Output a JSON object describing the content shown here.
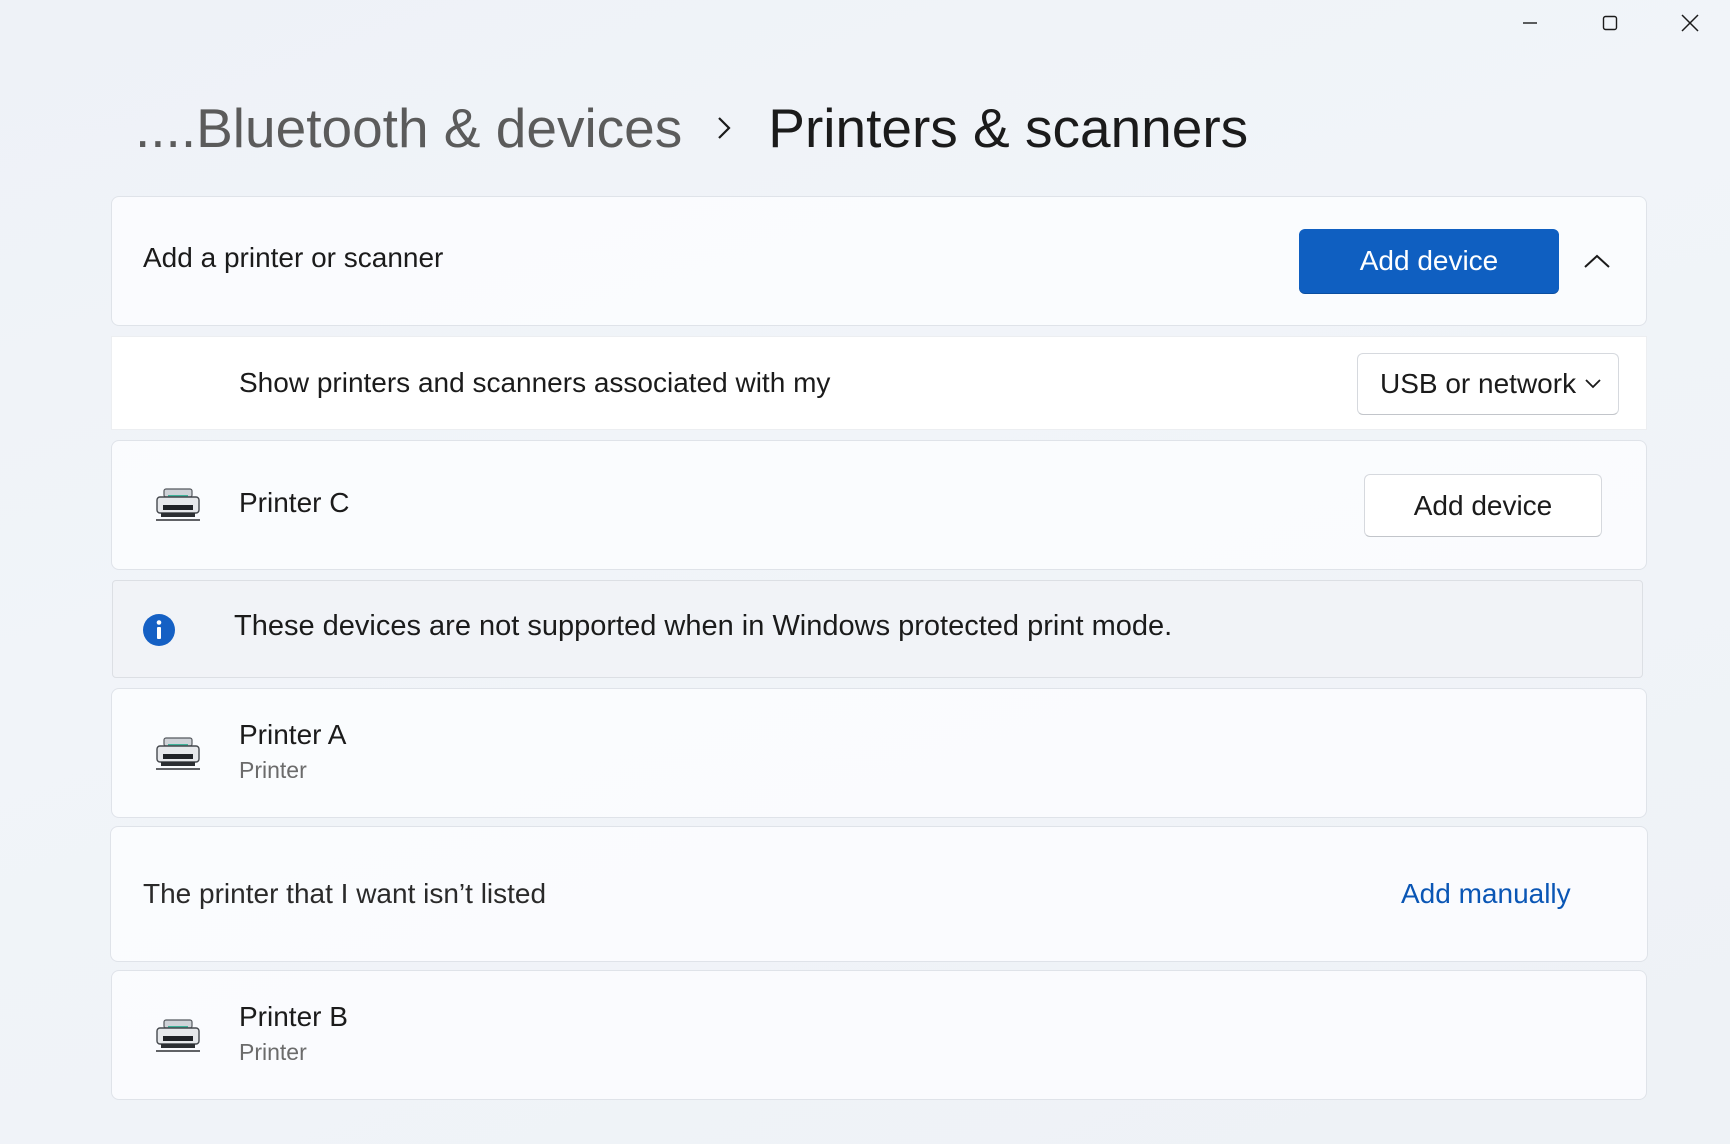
{
  "window": {
    "minimize_icon": "minimize-icon",
    "maximize_icon": "maximize-icon",
    "close_icon": "close-icon"
  },
  "breadcrumb": {
    "parent": "....Bluetooth & devices",
    "separator_icon": "chevron-right-icon",
    "current": "Printers & scanners"
  },
  "add_section": {
    "label": "Add a printer or scanner",
    "add_button": "Add device",
    "collapse_icon": "chevron-up-icon"
  },
  "filter": {
    "label": "Show printers and scanners associated with my",
    "selected": "USB or network"
  },
  "found_devices": [
    {
      "name": "Printer C",
      "button": "Add device",
      "icon": "printer-icon"
    }
  ],
  "info_bar": {
    "icon": "info-icon",
    "text": "These devices are not supported when in Windows protected print mode."
  },
  "unsupported_devices": [
    {
      "name": "Printer A",
      "type": "Printer",
      "icon": "printer-icon"
    }
  ],
  "manual": {
    "label": "The printer that I want isn’t listed",
    "link": "Add manually"
  },
  "more_devices": [
    {
      "name": "Printer B",
      "type": "Printer",
      "icon": "printer-icon"
    }
  ],
  "colors": {
    "accent": "#0f5fc1",
    "link": "#0a56b5",
    "info": "#1560c4"
  }
}
